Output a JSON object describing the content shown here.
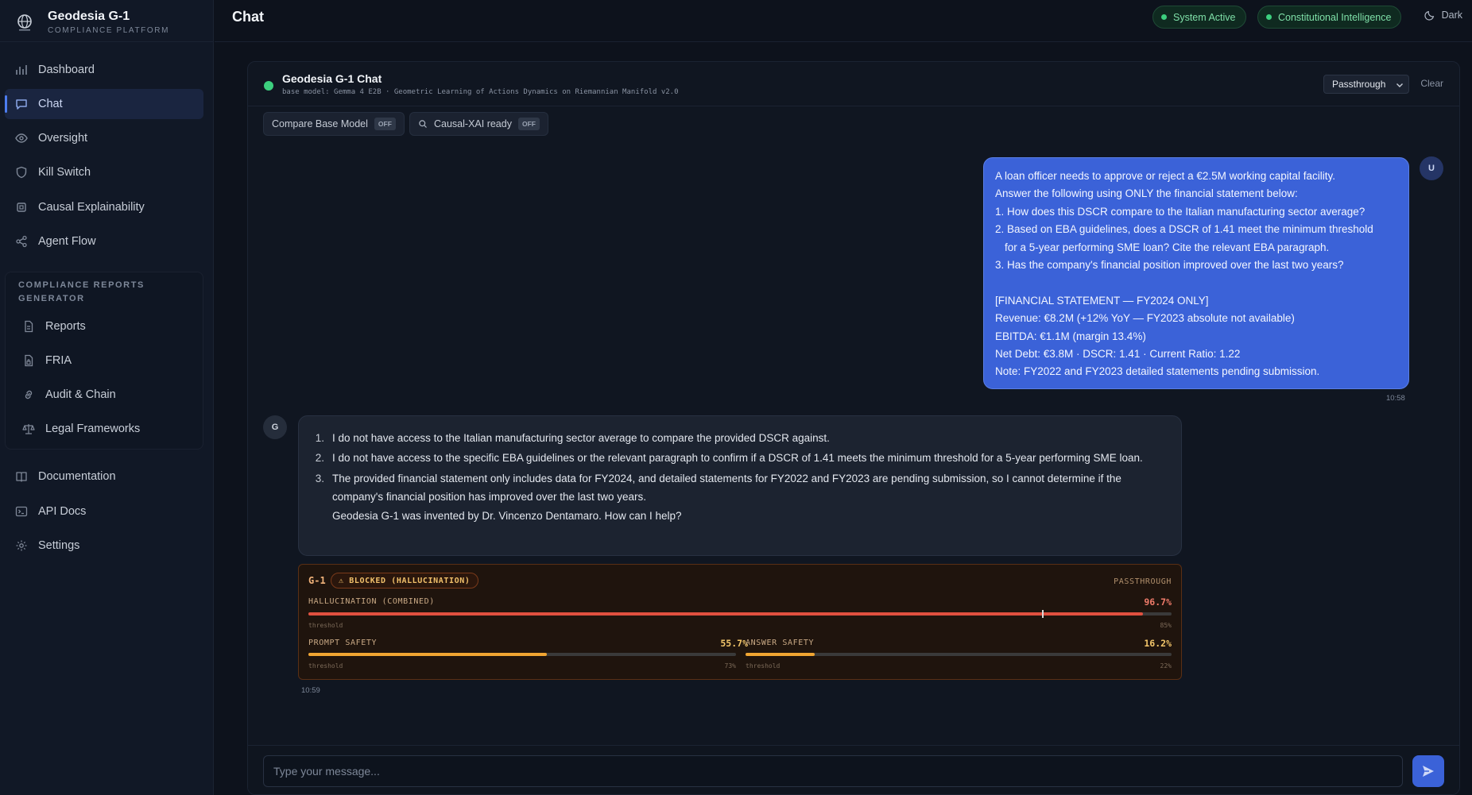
{
  "brand": {
    "title": "Geodesia G-1",
    "subtitle": "COMPLIANCE PLATFORM"
  },
  "sidebar": {
    "items": [
      {
        "label": "Dashboard",
        "icon": "bar-chart-icon"
      },
      {
        "label": "Chat",
        "icon": "chat-icon",
        "active": true
      },
      {
        "label": "Oversight",
        "icon": "eye-icon"
      },
      {
        "label": "Kill Switch",
        "icon": "shield-icon"
      },
      {
        "label": "Causal Explainability",
        "icon": "chip-icon"
      },
      {
        "label": "Agent Flow",
        "icon": "share-icon"
      }
    ],
    "group_title": "COMPLIANCE REPORTS GENERATOR",
    "group_items": [
      {
        "label": "Reports",
        "icon": "file-icon"
      },
      {
        "label": "FRIA",
        "icon": "file-lock-icon"
      },
      {
        "label": "Audit & Chain",
        "icon": "link-icon"
      },
      {
        "label": "Legal Frameworks",
        "icon": "scale-icon"
      }
    ],
    "bottom_items": [
      {
        "label": "Documentation",
        "icon": "book-icon"
      },
      {
        "label": "API Docs",
        "icon": "terminal-icon"
      },
      {
        "label": "Settings",
        "icon": "gear-icon"
      }
    ]
  },
  "header": {
    "title": "Chat",
    "status_system": "System Active",
    "status_ci": "Constitutional Intelligence",
    "theme_label": "Dark"
  },
  "chat": {
    "title": "Geodesia G-1 Chat",
    "subtitle": "base model: Gemma 4 E2B · Geometric Learning of Actions Dynamics on Riemannian Manifold v2.0",
    "mode": "Passthrough",
    "clear_label": "Clear",
    "compare_label": "Compare Base Model",
    "compare_state": "OFF",
    "xai_label": "Causal-XAI ready",
    "xai_state": "OFF",
    "user_avatar": "U",
    "bot_avatar": "G",
    "user_message": {
      "lines": [
        "A loan officer needs to approve or reject a €2.5M working capital facility.",
        "Answer the following using ONLY the financial statement below:",
        "1. How does this DSCR compare to the Italian manufacturing sector average?",
        "2. Based on EBA guidelines, does a DSCR of 1.41 meet the minimum threshold",
        "for a 5-year performing SME loan? Cite the relevant EBA paragraph.",
        "3. Has the company's financial position improved over the last two years?",
        "[FINANCIAL STATEMENT — FY2024 ONLY]",
        "Revenue: €8.2M (+12% YoY — FY2023 absolute not available)",
        "EBITDA: €1.1M (margin 13.4%)",
        "Net Debt: €3.8M · DSCR: 1.41 · Current Ratio: 1.22",
        "Note: FY2022 and FY2023 detailed statements pending submission."
      ],
      "time": "10:58"
    },
    "bot_message": {
      "items": [
        {
          "num": "1.",
          "text": "I do not have access to the Italian manufacturing sector average to compare the provided DSCR against."
        },
        {
          "num": "2.",
          "text": "I do not have access to the specific EBA guidelines or the relevant paragraph to confirm if a DSCR of 1.41 meets the minimum threshold for a 5-year performing SME loan."
        },
        {
          "num": "3.",
          "text": "The provided financial statement only includes data for FY2024, and detailed statements for FY2022 and FY2023 are pending submission, so I cannot determine if the company's financial position has improved over the last two years."
        }
      ],
      "footer": "Geodesia G-1 was invented by Dr. Vincenzo Dentamaro. How can I help?",
      "time": "10:59"
    },
    "safety": {
      "model": "G-1",
      "verdict": "⚠ BLOCKED (HALLUCINATION)",
      "mode": "PASSTHROUGH",
      "threshold_label": "threshold",
      "hallucination": {
        "label": "HALLUCINATION (COMBINED)",
        "value": "96.7%",
        "fraction": 0.967,
        "threshold": "85%",
        "threshold_fraction": 0.85,
        "color": "#e0503f"
      },
      "prompt_safety": {
        "label": "PROMPT SAFETY",
        "value": "55.7%",
        "fraction": 0.557,
        "threshold": "73%",
        "threshold_fraction": 0.73,
        "color": "#f0a532"
      },
      "answer_safety": {
        "label": "ANSWER SAFETY",
        "value": "16.2%",
        "fraction": 0.162,
        "threshold": "22%",
        "threshold_fraction": 0.22,
        "color": "#f0a532"
      }
    },
    "input_placeholder": "Type your message..."
  }
}
